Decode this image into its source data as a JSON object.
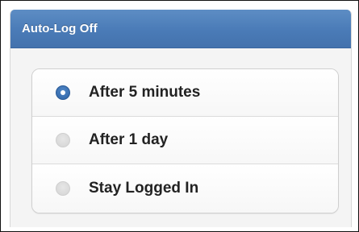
{
  "panel": {
    "title": "Auto-Log Off"
  },
  "options": [
    {
      "label": "After 5 minutes",
      "selected": true
    },
    {
      "label": "After 1 day",
      "selected": false
    },
    {
      "label": "Stay Logged In",
      "selected": false
    }
  ],
  "colors": {
    "header": "#4a7bb7",
    "radio_selected": "#2f64a6",
    "radio_unselected": "#d4d4d4"
  }
}
